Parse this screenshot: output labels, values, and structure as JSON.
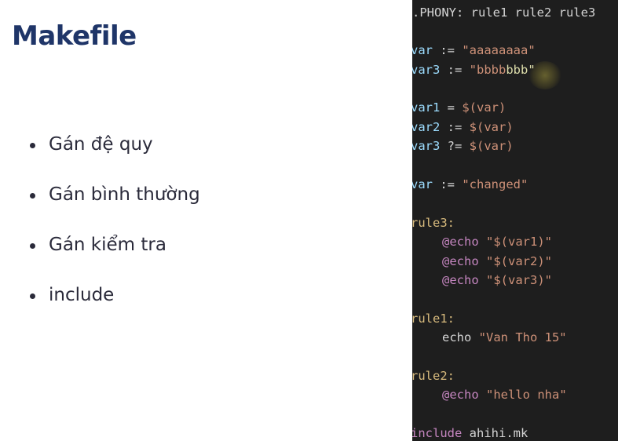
{
  "slide": {
    "title": "Makefile",
    "bullets": [
      "Gán đệ quy",
      "Gán bình thường",
      "Gán kiểm tra",
      "include"
    ]
  },
  "code": {
    "phony": ".PHONY: rule1 rule2 rule3",
    "l_var_name": "var",
    "l_var_op": " := ",
    "l_var_val": "\"aaaaaaaa\"",
    "l_var3_name": "var3",
    "l_var3_op": " := ",
    "l_var3_val_a": "\"bbbb",
    "l_var3_val_b": "bbb\"",
    "l_var1_name": "var1",
    "l_var1_op": " = ",
    "l_var1_val": "$(var)",
    "l_var2_name": "var2",
    "l_var2_op": " := ",
    "l_var2_val": "$(var)",
    "l_var3b_name": "var3",
    "l_var3b_op": " ?= ",
    "l_var3b_val": "$(var)",
    "l_varc_name": "var",
    "l_varc_op": " := ",
    "l_varc_val": "\"changed\"",
    "rule3": "rule3:",
    "echo1_kw": "@echo",
    "echo1_val": " \"$(var1)\"",
    "echo2_kw": "@echo",
    "echo2_val": " \"$(var2)\"",
    "echo3_kw": "@echo",
    "echo3_val": " \"$(var3)\"",
    "rule1": "rule1:",
    "echo4_kw": "echo",
    "echo4_val": " \"Van Tho 15\"",
    "rule2": "rule2:",
    "echo5_kw": "@echo",
    "echo5_val": " \"hello nha\"",
    "include_kw": "include",
    "include_val": " ahihi.mk"
  },
  "colors": {
    "title": "#1f3568",
    "editor_bg": "#1e1e1e",
    "target": "#d7ba7d",
    "variable": "#9cdcfe",
    "string": "#ce9178",
    "keyword": "#c586c0"
  }
}
